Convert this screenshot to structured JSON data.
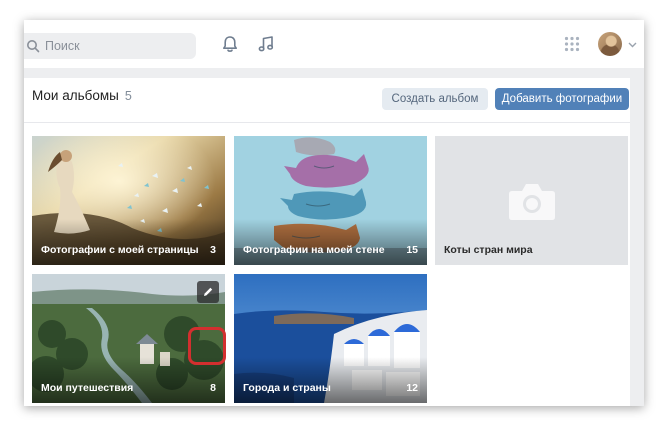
{
  "header": {
    "search_placeholder": "Поиск",
    "icons": [
      "search-icon",
      "bell-icon",
      "music-icon",
      "apps-grid-icon",
      "avatar",
      "chevron-down-icon"
    ]
  },
  "albums_section": {
    "title": "Мои альбомы",
    "count": "5",
    "create_button": "Создать альбом",
    "add_photos_button": "Добавить фотографии"
  },
  "albums": [
    {
      "title": "Фотографии с моей страницы",
      "count": "3"
    },
    {
      "title": "Фотографии на моей стене",
      "count": "15"
    },
    {
      "title": "Коты стран мира",
      "count": ""
    },
    {
      "title": "Мои путешествия",
      "count": "8"
    },
    {
      "title": "Города и страны",
      "count": "12"
    }
  ],
  "colors": {
    "accent": "#5181b8",
    "secondary_button": "#e5ebf1",
    "background": "#edeef0",
    "highlight": "#d32f2f"
  }
}
